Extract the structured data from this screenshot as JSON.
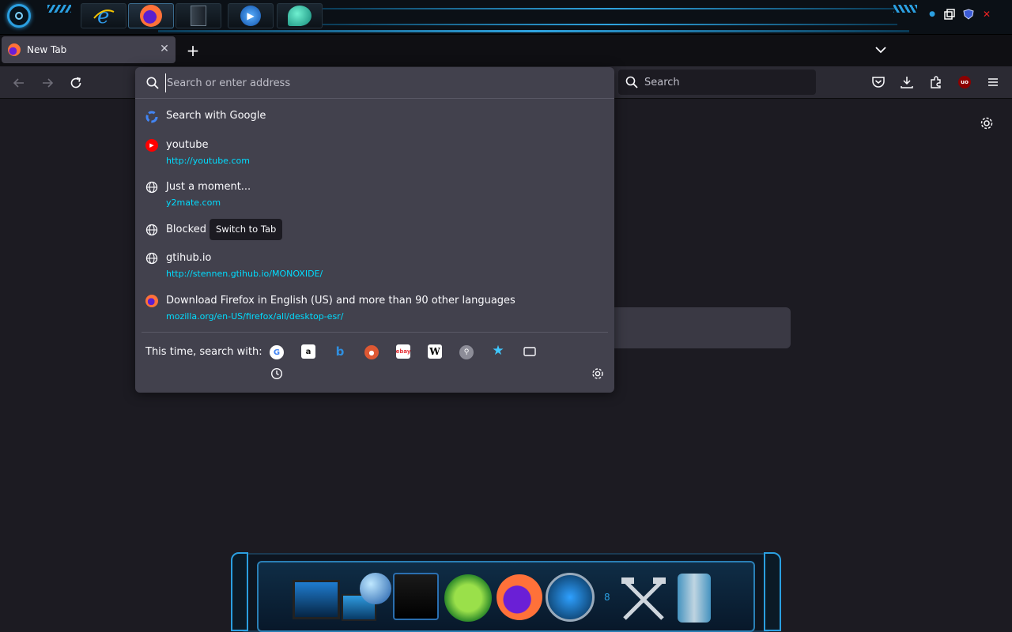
{
  "tab": {
    "label": "New Tab",
    "close": "✕"
  },
  "newtab": "+",
  "searchbar": {
    "placeholder": "Search"
  },
  "urlbar": {
    "placeholder": "Search or enter address",
    "results": [
      {
        "title": "Search with Google",
        "url": "",
        "icon": "google-icon"
      },
      {
        "title": "youtube",
        "url": "http://youtube.com",
        "icon": "youtube-icon"
      },
      {
        "title": "Just a moment...",
        "url": "y2mate.com",
        "icon": "globe-icon"
      },
      {
        "title": "Blocked",
        "url": "",
        "icon": "globe-icon"
      },
      {
        "title": "gtihub.io",
        "url": "http://stennen.gtihub.io/MONOXIDE/",
        "icon": "globe-icon"
      },
      {
        "title": "Download Firefox in English (US) and more than 90 other languages",
        "url": "mozilla.org/en-US/firefox/all/desktop-esr/",
        "icon": "firefox-icon"
      }
    ],
    "switch_to_tab": "Switch to Tab",
    "oneoff_label": "This time, search with:",
    "engines": [
      "google-icon",
      "amazon-icon",
      "bing-icon",
      "duckduckgo-icon",
      "ebay-icon",
      "wikipedia-icon",
      "search-engine-icon",
      "bookmarks-icon",
      "tabs-icon",
      "history-icon"
    ]
  },
  "colors": {
    "accent_link": "#00ddff",
    "panel": "#42414d",
    "toolbar": "#2b2a33",
    "page": "#1c1b22"
  }
}
